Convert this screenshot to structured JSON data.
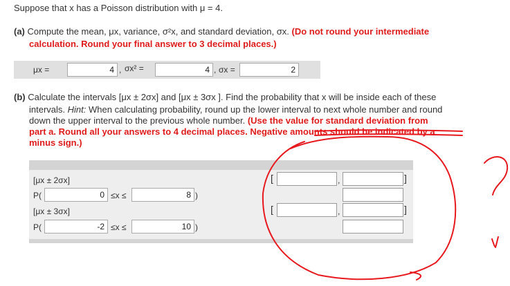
{
  "intro": "Suppose that x has a Poisson distribution with μ = 4.",
  "part_a": {
    "label": "(a)",
    "line1": "Compute the mean, μx, variance, σ²x, and standard deviation, σx.",
    "instr1": "(Do not round your intermediate",
    "instr2": "calculation. Round your final answer to 3 decimal places.)",
    "mean_label": "μx =",
    "var_label": "σx² =",
    "sd_label": "σx =",
    "mean_value": "4",
    "var_value": "4",
    "sd_value": "2"
  },
  "part_b": {
    "label": "(b)",
    "line1": "Calculate the intervals [μx ± 2σx] and [μx ± 3σx ]. Find the probability that x will be inside each of these",
    "line2a": "intervals.",
    "hint_word": "Hint:",
    "line2b": "When calculating probability, round up the lower interval to next whole number and round",
    "line3": "down the upper interval to the previous whole number.",
    "instr_a": "(Use the value for standard deviation from",
    "instr_b": "part a. Round all your answers to 4 decimal places. Negative amounts should be indicated by a",
    "instr_c": "minus sign.)"
  },
  "table": {
    "row1_label": "[μx ± 2σx]",
    "row2_prefix": "P(",
    "row2_low": "0",
    "row2_mid": "≤x ≤",
    "row2_high": "8",
    "row2_suffix": ")",
    "row3_label": "[μx ± 3σx]",
    "row4_prefix": "P(",
    "row4_low": "-2",
    "row4_mid": "≤x ≤",
    "row4_high": "10",
    "row4_suffix": ")",
    "bracket_open": "[",
    "comma": ",",
    "bracket_close": "]"
  },
  "annotation": {
    "question_mark": "?",
    "scribble": "υ",
    "ink_color": "#e8191e"
  },
  "colors": {
    "red_text": "#e01b1b",
    "answer_bar": "#e0e0e0",
    "table_row": "#eeeeee"
  }
}
